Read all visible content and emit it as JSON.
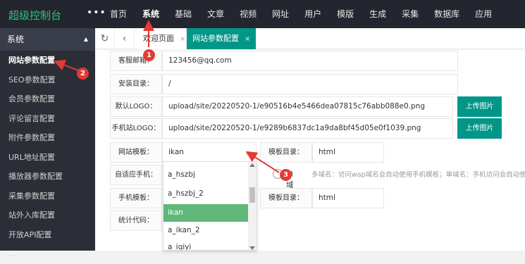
{
  "brand": "超级控制台",
  "top_menu_icon": "more-dots-icon",
  "nav": [
    "首页",
    "系统",
    "基础",
    "文章",
    "视频",
    "网址",
    "用户",
    "模版",
    "生成",
    "采集",
    "数据库",
    "应用"
  ],
  "sidebar": {
    "header": "系统",
    "items": [
      "网站参数配置",
      "SEO参数配置",
      "会员参数配置",
      "评论留言配置",
      "附件参数配置",
      "URL地址配置",
      "播放器参数配置",
      "采集参数配置",
      "站外入库配置",
      "开放API配置",
      "..."
    ]
  },
  "tabs": {
    "refresh_icon": "refresh-icon",
    "back_icon": "chevron-left-icon",
    "welcome": "欢迎页面",
    "active": "网站参数配置",
    "close": "×"
  },
  "form": {
    "email_label": "客服邮箱：",
    "email_value": "123456@qq.com",
    "install_label": "安装目录：",
    "install_value": "/",
    "logo_label": "默认LOGO：",
    "logo_value": "upload/site/20220520-1/e90516b4e5466dea07815c76abb088e0.png",
    "mobile_logo_label": "手机站LOGO：",
    "mobile_logo_value": "upload/site/20220520-1/e9289b6837dc1a9da8bf45d05e0f1039.png",
    "upload_label": "上传图片",
    "template_label": "网站模板：",
    "template_value": "ikan",
    "template_dir_label": "模板目录：",
    "template_dir_value": "html",
    "adaptive_label": "自适应手机：",
    "single_domain_label": "单域",
    "adaptive_hint": "多域名：访问wap域名会自动使用手机模板；单域名：手机访问会自动使",
    "mobile_template_label": "手机模板：",
    "mobile_template_dir_label": "模板目录：",
    "mobile_template_dir_value": "html",
    "stats_label": "统计代码："
  },
  "dropdown": {
    "options": [
      "a_hszbj",
      "a_hszbj_2",
      "ikan",
      "a_ikan_2",
      "a_iqiyi"
    ],
    "selected": "ikan"
  },
  "annotations": {
    "markers": [
      "1",
      "2",
      "3"
    ],
    "color": "#e53935"
  }
}
